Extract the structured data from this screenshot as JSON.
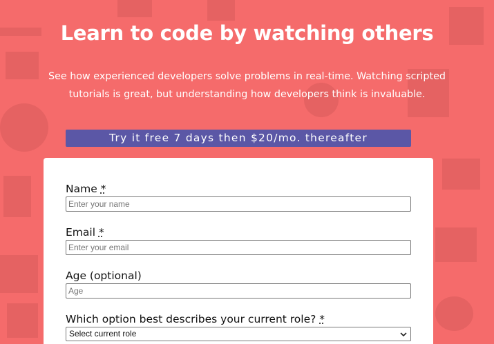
{
  "hero": {
    "title": "Learn to code by watching others",
    "subtitle": "See how experienced developers solve problems in real-time. Watching scripted tutorials is great, but understanding how developers think is invaluable.",
    "trial_banner": "Try it free 7 days then $20/mo. thereafter"
  },
  "form": {
    "name": {
      "label": "Name",
      "required_mark": "*",
      "placeholder": "Enter your name"
    },
    "email": {
      "label": "Email",
      "required_mark": "*",
      "placeholder": "Enter your email"
    },
    "age": {
      "label": "Age (optional)",
      "placeholder": "Age"
    },
    "role": {
      "label": "Which option best describes your current role?",
      "required_mark": "*",
      "selected": "Select current role",
      "icon": "chevron-down-icon"
    }
  },
  "colors": {
    "background": "#f56b6b",
    "banner": "#5b57a6",
    "card": "#ffffff",
    "text_light": "#ffffff"
  }
}
